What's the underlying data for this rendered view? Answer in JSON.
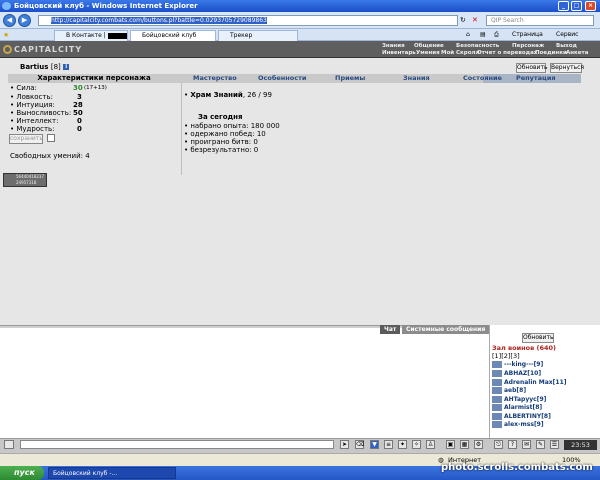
{
  "window": {
    "title": "Бойцовский клуб - Windows Internet Explorer",
    "min": "_",
    "max": "□",
    "close": "×"
  },
  "address": {
    "url": "http://capitalcity.combats.com/buttons.pl?battle=0.0293705729089863",
    "search_placeholder": "QIP Search"
  },
  "tabs": [
    {
      "label": "В Контакте |"
    },
    {
      "label": "Бойцовский клуб"
    },
    {
      "label": "Трекер"
    }
  ],
  "toolbar": {
    "page": "Страница",
    "service": "Сервис"
  },
  "game": {
    "logo": "CAPITALCITY",
    "menu_top": [
      "Знания",
      "Общение",
      "Безопасность",
      "Персонаж",
      "Выход"
    ],
    "menu_bottom": [
      "Инвентарь",
      "Умения",
      "Мой Скролл",
      "Отчет о переводах",
      "Поединки",
      "Анкета"
    ],
    "char_name": "Bartius",
    "char_level": "[8]",
    "btn_refresh": "Обновить",
    "btn_return": "Вернуться",
    "char_header": "Характеристики персонажа",
    "panel_tabs": [
      "Мастерство",
      "Особенности",
      "Приемы",
      "Знания",
      "Состояние",
      "Репутация"
    ],
    "stats": [
      {
        "label": "Сила:",
        "value": "30",
        "bonus": "(17+13)"
      },
      {
        "label": "Ловкость:",
        "value": "3"
      },
      {
        "label": "Интуиция:",
        "value": "28"
      },
      {
        "label": "Выносливость:",
        "value": "50"
      },
      {
        "label": "Интеллект:",
        "value": "0"
      },
      {
        "label": "Мудрость:",
        "value": "0"
      }
    ],
    "save_button": "сохранить",
    "free_skills": "Свободных умений: 4",
    "temple": "Храм Знаний",
    "temple_value": ", 26 / 99",
    "today_title": "За сегодня",
    "today": [
      "набрано опыта: 180 000",
      "одержано побед: 10",
      "проиграно битв: 0",
      "безрезультатно: 0"
    ],
    "counter_line1": "56440418237",
    "counter_line2": "24957318"
  },
  "chat": {
    "tab_chat": "Чат",
    "tab_system": "Системные сообщения",
    "refresh": "Обновить",
    "room": "Зал воинов (640)",
    "pages": "[1][2][3]",
    "users": [
      {
        "name": "---king---",
        "level": "[9]"
      },
      {
        "name": "ABHAZ",
        "level": "[10]"
      },
      {
        "name": "Adrenalin Max",
        "level": "[11]"
      },
      {
        "name": "aeb",
        "level": "[8]"
      },
      {
        "name": "AHTapyyc",
        "level": "[9]"
      },
      {
        "name": "Alarmist",
        "level": "[8]"
      },
      {
        "name": "ALBERTINY",
        "level": "[8]"
      },
      {
        "name": "alex-mss",
        "level": "[9]"
      }
    ],
    "clock": "23:53"
  },
  "status": {
    "internet": "Интернет",
    "zoom": "100%"
  },
  "taskbar": {
    "start": "пуск",
    "item": "Бойцовский клуб -..."
  },
  "watermark": "photo.scrolls.combats.com"
}
